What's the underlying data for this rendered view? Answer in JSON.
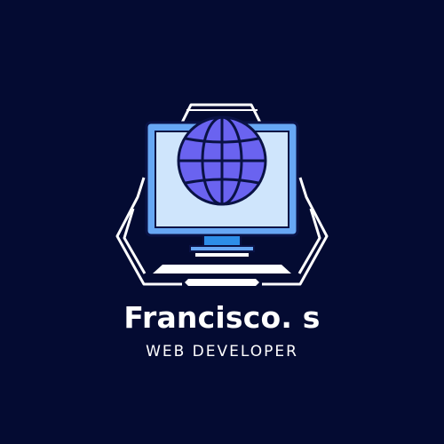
{
  "brand": {
    "name": "Francisco. s",
    "tagline": "WEB DEVELOPER"
  },
  "colors": {
    "background": "#040b32",
    "frame": "#ffffff",
    "monitor_body": "#67a7f4",
    "monitor_screen": "#cfe5fc",
    "globe_fill": "#6a63f0",
    "globe_outline": "#0a1245",
    "stand": "#2d8ee8"
  },
  "icons": {
    "logo": "computer-globe-icon"
  }
}
